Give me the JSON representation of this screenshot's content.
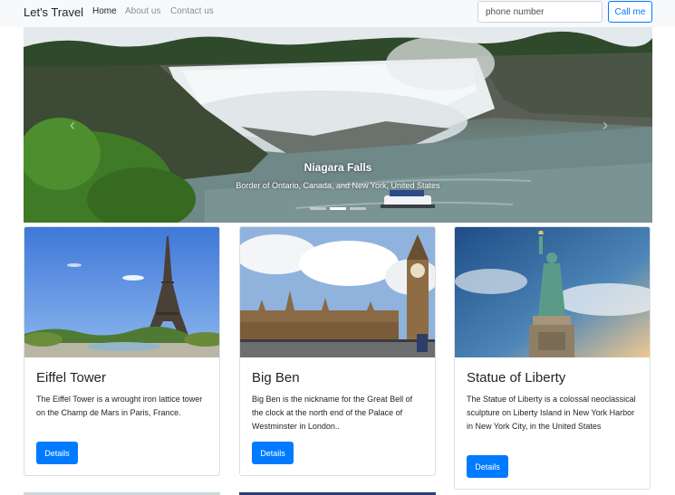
{
  "navbar": {
    "brand": "Let's Travel",
    "links": [
      "Home",
      "About us",
      "Contact us"
    ],
    "phone_placeholder": "phone number",
    "call_label": "Call me"
  },
  "carousel": {
    "prev_glyph": "‹",
    "next_glyph": "›",
    "slide": {
      "title": "Niagara Falls",
      "subtitle": "Border of Ontario, Canada, and New York, United States"
    },
    "indicator_count": 3,
    "active_indicator": 1
  },
  "cards": [
    {
      "title": "Eiffel Tower",
      "text": "The Eiffel Tower is a wrought iron lattice tower on the Champ de Mars in Paris, France.",
      "button": "Details"
    },
    {
      "title": "Big Ben",
      "text": "Big Ben is the nickname for the Great Bell of the clock at the north end of the Palace of Westminster in London..",
      "button": "Details"
    },
    {
      "title": "Statue of Liberty",
      "text": "The Statue of Liberty is a colossal neoclassical sculpture on Liberty Island in New York Harbor in New York City, in the United States",
      "button": "Details"
    }
  ],
  "colors": {
    "primary": "#007bff",
    "navbar_bg": "#f8f9fa",
    "card_border": "#dcdfe2"
  }
}
